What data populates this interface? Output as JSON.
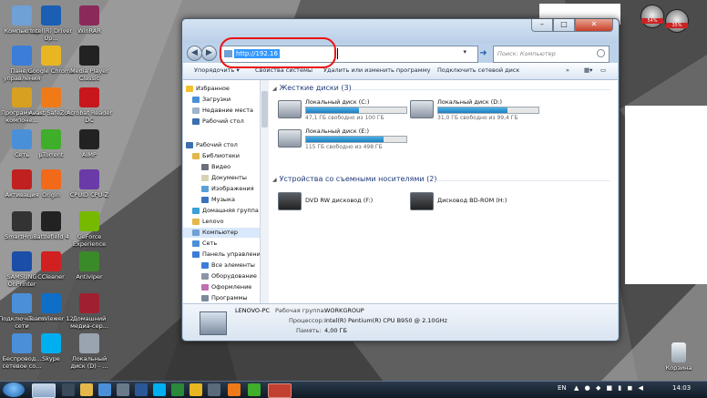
{
  "desktop": {
    "icons": [
      {
        "label": "Компьютер",
        "color": "#6fa0d6"
      },
      {
        "label": "Intel(R) Driver Up...",
        "color": "#1a5fb4"
      },
      {
        "label": "WinRAR",
        "color": "#8b2a5a"
      },
      {
        "label": "Панель управления",
        "color": "#3b7dd8"
      },
      {
        "label": "Google Chrome",
        "color": "#e7b622"
      },
      {
        "label": "Media Player Classic",
        "color": "#222222"
      },
      {
        "label": "Программы и компоне...",
        "color": "#d8a020"
      },
      {
        "label": "Avast SafeZo...",
        "color": "#f07a18"
      },
      {
        "label": "Acrobat Reader DC",
        "color": "#c8161d"
      },
      {
        "label": "Сеть",
        "color": "#4a90d9"
      },
      {
        "label": "µTorrent",
        "color": "#3fae2a"
      },
      {
        "label": "AIMP",
        "color": "#222222"
      },
      {
        "label": "Активация",
        "color": "#c02020"
      },
      {
        "label": "Origin",
        "color": "#f06a1a"
      },
      {
        "label": "CPUID CPU-Z",
        "color": "#6a3aa8"
      },
      {
        "label": "SmartHru-..",
        "color": "#333333"
      },
      {
        "label": "Battlefield 4",
        "color": "#222222"
      },
      {
        "label": "GeForce Experience",
        "color": "#76b900"
      },
      {
        "label": "SAMSUNG OnPrinter",
        "color": "#1a4ea8"
      },
      {
        "label": "CCleaner",
        "color": "#d02020"
      },
      {
        "label": "Antiviper",
        "color": "#3a8a2a"
      },
      {
        "label": "Подключе... по сети",
        "color": "#4a90d9"
      },
      {
        "label": "TeamViewer 12",
        "color": "#0e6ec8"
      },
      {
        "label": "Домашний медиа-сер...",
        "color": "#a02030"
      },
      {
        "label": "Беспровод... сетевое со...",
        "color": "#4a90d9"
      },
      {
        "label": "Skype",
        "color": "#00aff0"
      },
      {
        "label": "Локальный диск (D) - ...",
        "color": "#9aa4b0"
      }
    ],
    "recycle_bin": "Корзина"
  },
  "window": {
    "address_value": "http://192.16",
    "search_placeholder": "Поиск: Компьютер",
    "toolbar": {
      "organize": "Упорядочить ▾",
      "system_properties": "Свойства системы",
      "uninstall": "Удалить или изменить программу",
      "map_drive": "Подключить сетевой диск",
      "more": "»"
    },
    "nav": {
      "favorites": "Избранное",
      "downloads": "Загрузки",
      "recent": "Недавние места",
      "desktop": "Рабочий стол",
      "desktop2": "Рабочий стол",
      "libraries": "Библиотеки",
      "video": "Видео",
      "documents": "Документы",
      "images": "Изображения",
      "music": "Музыка",
      "homegroup": "Домашняя группа",
      "lenovo": "Lenovo",
      "computer": "Компьютер",
      "network": "Сеть",
      "control_panel": "Панель управления",
      "all_items": "Все элементы",
      "hardware": "Оборудование",
      "appearance": "Оформление",
      "programs": "Программы"
    },
    "groups": {
      "hard_drives": "Жесткие диски (3)",
      "removable": "Устройства со съемными носителями (2)"
    },
    "drives": [
      {
        "name": "Локальный диск (C:)",
        "free": "47,1 ГБ свободно из 100 ГБ",
        "used_fraction": 0.53
      },
      {
        "name": "Локальный диск (D:)",
        "free": "31,0 ГБ свободно из 99,4 ГБ",
        "used_fraction": 0.69
      },
      {
        "name": "Локальный диск (E:)",
        "free": "115 ГБ свободно из 498 ГБ",
        "used_fraction": 0.77
      }
    ],
    "removable": [
      {
        "name": "DVD RW дисковод (F:)"
      },
      {
        "name": "Дисковод BD-ROM (H:)"
      }
    ],
    "details": {
      "pc_name": "LENOVO-PC",
      "workgroup_label": "Рабочая группа:",
      "workgroup_value": "WORKGROUP",
      "cpu_label": "Процессор:",
      "cpu_value": "Intel(R) Pentium(R) CPU B950 @ 2.10GHz",
      "mem_label": "Память:",
      "mem_value": "4,00 ГБ"
    }
  },
  "gadget": {
    "cpu": "54%",
    "ram": "35%"
  },
  "taskbar": {
    "lang": "EN",
    "time": "14:03"
  }
}
